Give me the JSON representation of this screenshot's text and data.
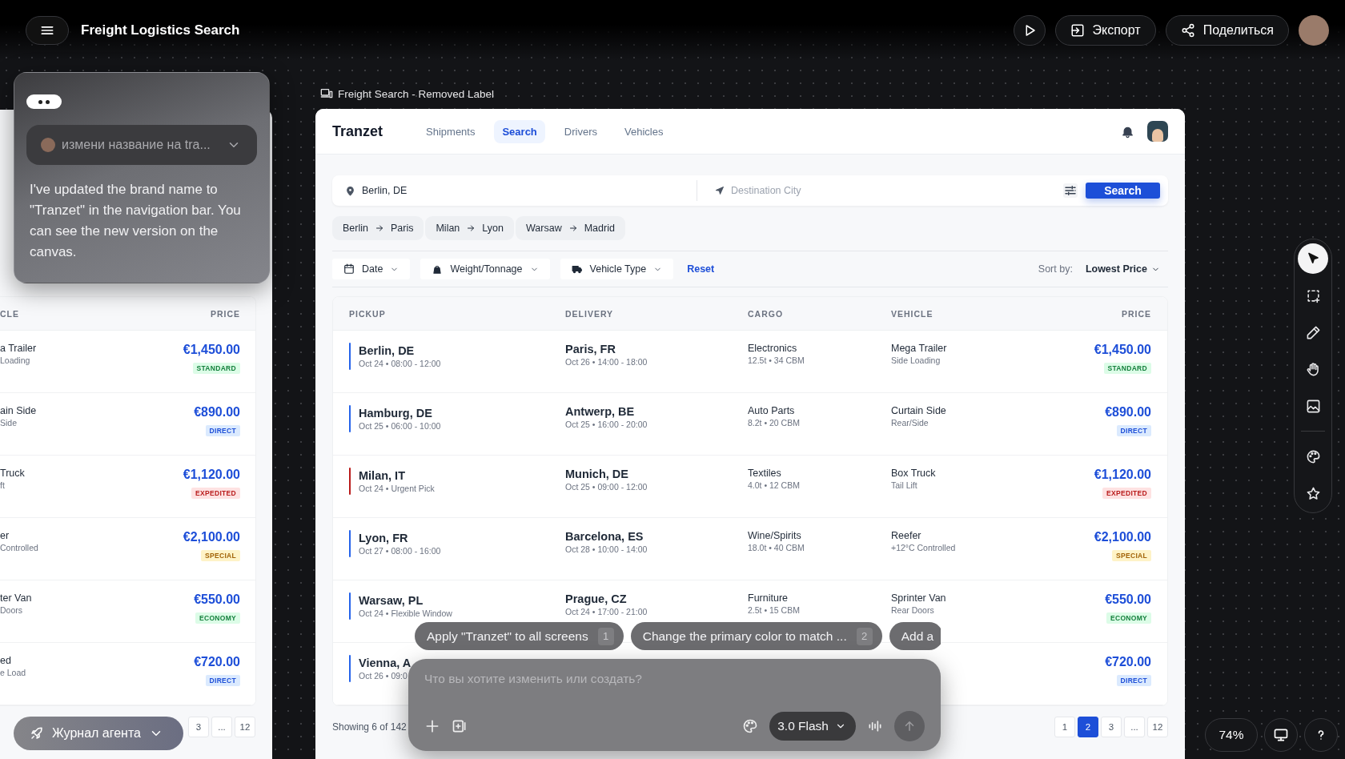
{
  "topbar": {
    "title": "Freight Logistics Search",
    "export": "Экспорт",
    "share": "Поделиться"
  },
  "chat": {
    "prompt": "измени название на tra...",
    "message": "I've updated the brand name to \"Tranzet\" in the navigation bar. You can see the new version on the canvas."
  },
  "back_frame": {
    "columns": [
      "CLE",
      "PRICE"
    ],
    "rows": [
      {
        "vehicle": "a Trailer",
        "vehicle_detail": "Loading",
        "price": "€1,450.00",
        "badge": {
          "label": "STANDARD",
          "kind": "success"
        }
      },
      {
        "vehicle": "ain Side",
        "vehicle_detail": "Side",
        "price": "€890.00",
        "badge": {
          "label": "DIRECT",
          "kind": "info"
        }
      },
      {
        "vehicle": "Truck",
        "vehicle_detail": "ft",
        "price": "€1,120.00",
        "badge": {
          "label": "EXPEDITED",
          "kind": "danger"
        }
      },
      {
        "vehicle": "er",
        "vehicle_detail": "Controlled",
        "price": "€2,100.00",
        "badge": {
          "label": "SPECIAL",
          "kind": "warning"
        }
      },
      {
        "vehicle": "ter Van",
        "vehicle_detail": "Doors",
        "price": "€550.00",
        "badge": {
          "label": "ECONOMY",
          "kind": "success"
        }
      },
      {
        "vehicle": "ed",
        "vehicle_detail": "e Load",
        "price": "€720.00",
        "badge": {
          "label": "DIRECT",
          "kind": "info"
        }
      }
    ],
    "pages": [
      {
        "label": "3",
        "selected": false
      },
      {
        "label": "...",
        "selected": false
      },
      {
        "label": "12",
        "selected": false
      }
    ]
  },
  "frame": {
    "label": "Freight Search - Removed Label",
    "brand": "Tranzet",
    "tabs": [
      {
        "label": "Shipments",
        "selected": false
      },
      {
        "label": "Search",
        "selected": true
      },
      {
        "label": "Drivers",
        "selected": false
      },
      {
        "label": "Vehicles",
        "selected": false
      }
    ],
    "origin": {
      "value": "Berlin, DE"
    },
    "destination": {
      "placeholder": "Destination City"
    },
    "search_button": "Search",
    "routes": [
      {
        "from": "Berlin",
        "to": "Paris"
      },
      {
        "from": "Milan",
        "to": "Lyon"
      },
      {
        "from": "Warsaw",
        "to": "Madrid"
      }
    ],
    "filters": [
      {
        "label": "Date",
        "kind": "date"
      },
      {
        "label": "Weight/Tonnage",
        "kind": "weight"
      },
      {
        "label": "Vehicle Type",
        "kind": "vehicle"
      }
    ],
    "reset": "Reset",
    "sort_label": "Sort by:",
    "sort_value": "Lowest Price",
    "table": {
      "columns": [
        "PICKUP",
        "DELIVERY",
        "CARGO",
        "VEHICLE",
        "PRICE"
      ],
      "rows": [
        {
          "pickup": "Berlin, DE",
          "pickup_time": "Oct 24 • 08:00 - 12:00",
          "color": "#2563eb",
          "delivery": "Paris, FR",
          "delivery_time": "Oct 26 • 14:00 - 18:00",
          "cargo": "Electronics",
          "cargo_detail": "12.5t • 34 CBM",
          "vehicle": "Mega Trailer",
          "vehicle_detail": "Side Loading",
          "price": "€1,450.00",
          "badge": {
            "label": "STANDARD",
            "kind": "success"
          }
        },
        {
          "pickup": "Hamburg, DE",
          "pickup_time": "Oct 25 • 06:00 - 10:00",
          "color": "#2563eb",
          "delivery": "Antwerp, BE",
          "delivery_time": "Oct 25 • 16:00 - 20:00",
          "cargo": "Auto Parts",
          "cargo_detail": "8.2t • 20 CBM",
          "vehicle": "Curtain Side",
          "vehicle_detail": "Rear/Side",
          "price": "€890.00",
          "badge": {
            "label": "DIRECT",
            "kind": "info"
          }
        },
        {
          "pickup": "Milan, IT",
          "pickup_time": "Oct 24 • Urgent Pick",
          "color": "#b91c1c",
          "delivery": "Munich, DE",
          "delivery_time": "Oct 25 • 09:00 - 12:00",
          "cargo": "Textiles",
          "cargo_detail": "4.0t • 12 CBM",
          "vehicle": "Box Truck",
          "vehicle_detail": "Tail Lift",
          "price": "€1,120.00",
          "badge": {
            "label": "EXPEDITED",
            "kind": "danger"
          }
        },
        {
          "pickup": "Lyon, FR",
          "pickup_time": "Oct 27 • 08:00 - 16:00",
          "color": "#2563eb",
          "delivery": "Barcelona, ES",
          "delivery_time": "Oct 28 • 10:00 - 14:00",
          "cargo": "Wine/Spirits",
          "cargo_detail": "18.0t • 40 CBM",
          "vehicle": "Reefer",
          "vehicle_detail": "+12°C Controlled",
          "price": "€2,100.00",
          "badge": {
            "label": "SPECIAL",
            "kind": "warning"
          }
        },
        {
          "pickup": "Warsaw, PL",
          "pickup_time": "Oct 24 • Flexible Window",
          "color": "#2563eb",
          "delivery": "Prague, CZ",
          "delivery_time": "Oct 24 • 17:00 - 21:00",
          "cargo": "Furniture",
          "cargo_detail": "2.5t • 15 CBM",
          "vehicle": "Sprinter Van",
          "vehicle_detail": "Rear Doors",
          "price": "€550.00",
          "badge": {
            "label": "ECONOMY",
            "kind": "success"
          }
        },
        {
          "pickup": "Vienna, A",
          "pickup_time": "Oct 26 • 09:0",
          "color": "#2563eb",
          "price": "€720.00",
          "badge": {
            "label": "DIRECT",
            "kind": "info"
          }
        }
      ]
    },
    "showing": "Showing 6 of 142",
    "pages": [
      {
        "label": "1",
        "selected": false
      },
      {
        "label": "2",
        "selected": true
      },
      {
        "label": "3",
        "selected": false
      },
      {
        "label": "...",
        "selected": false
      },
      {
        "label": "12",
        "selected": false
      }
    ]
  },
  "tool_groups": [
    [
      {
        "kind": "pointer",
        "selected": true
      },
      {
        "kind": "marquee",
        "selected": false
      },
      {
        "kind": "pencil",
        "selected": false
      },
      {
        "kind": "hand",
        "selected": false
      },
      {
        "kind": "image",
        "selected": false
      }
    ],
    [
      {
        "kind": "palette",
        "selected": false
      },
      {
        "kind": "star",
        "selected": false
      }
    ]
  ],
  "suggestions": [
    {
      "text": "Apply \"Tranzet\" to all screens",
      "number": "1"
    },
    {
      "text": "Change the primary color to match ...",
      "number": "2"
    },
    {
      "text": "Add a"
    }
  ],
  "composer": {
    "placeholder": "Что вы хотите изменить или создать?",
    "model": "3.0 Flash"
  },
  "agent_log": "Журнал агента",
  "zoom": "74%"
}
